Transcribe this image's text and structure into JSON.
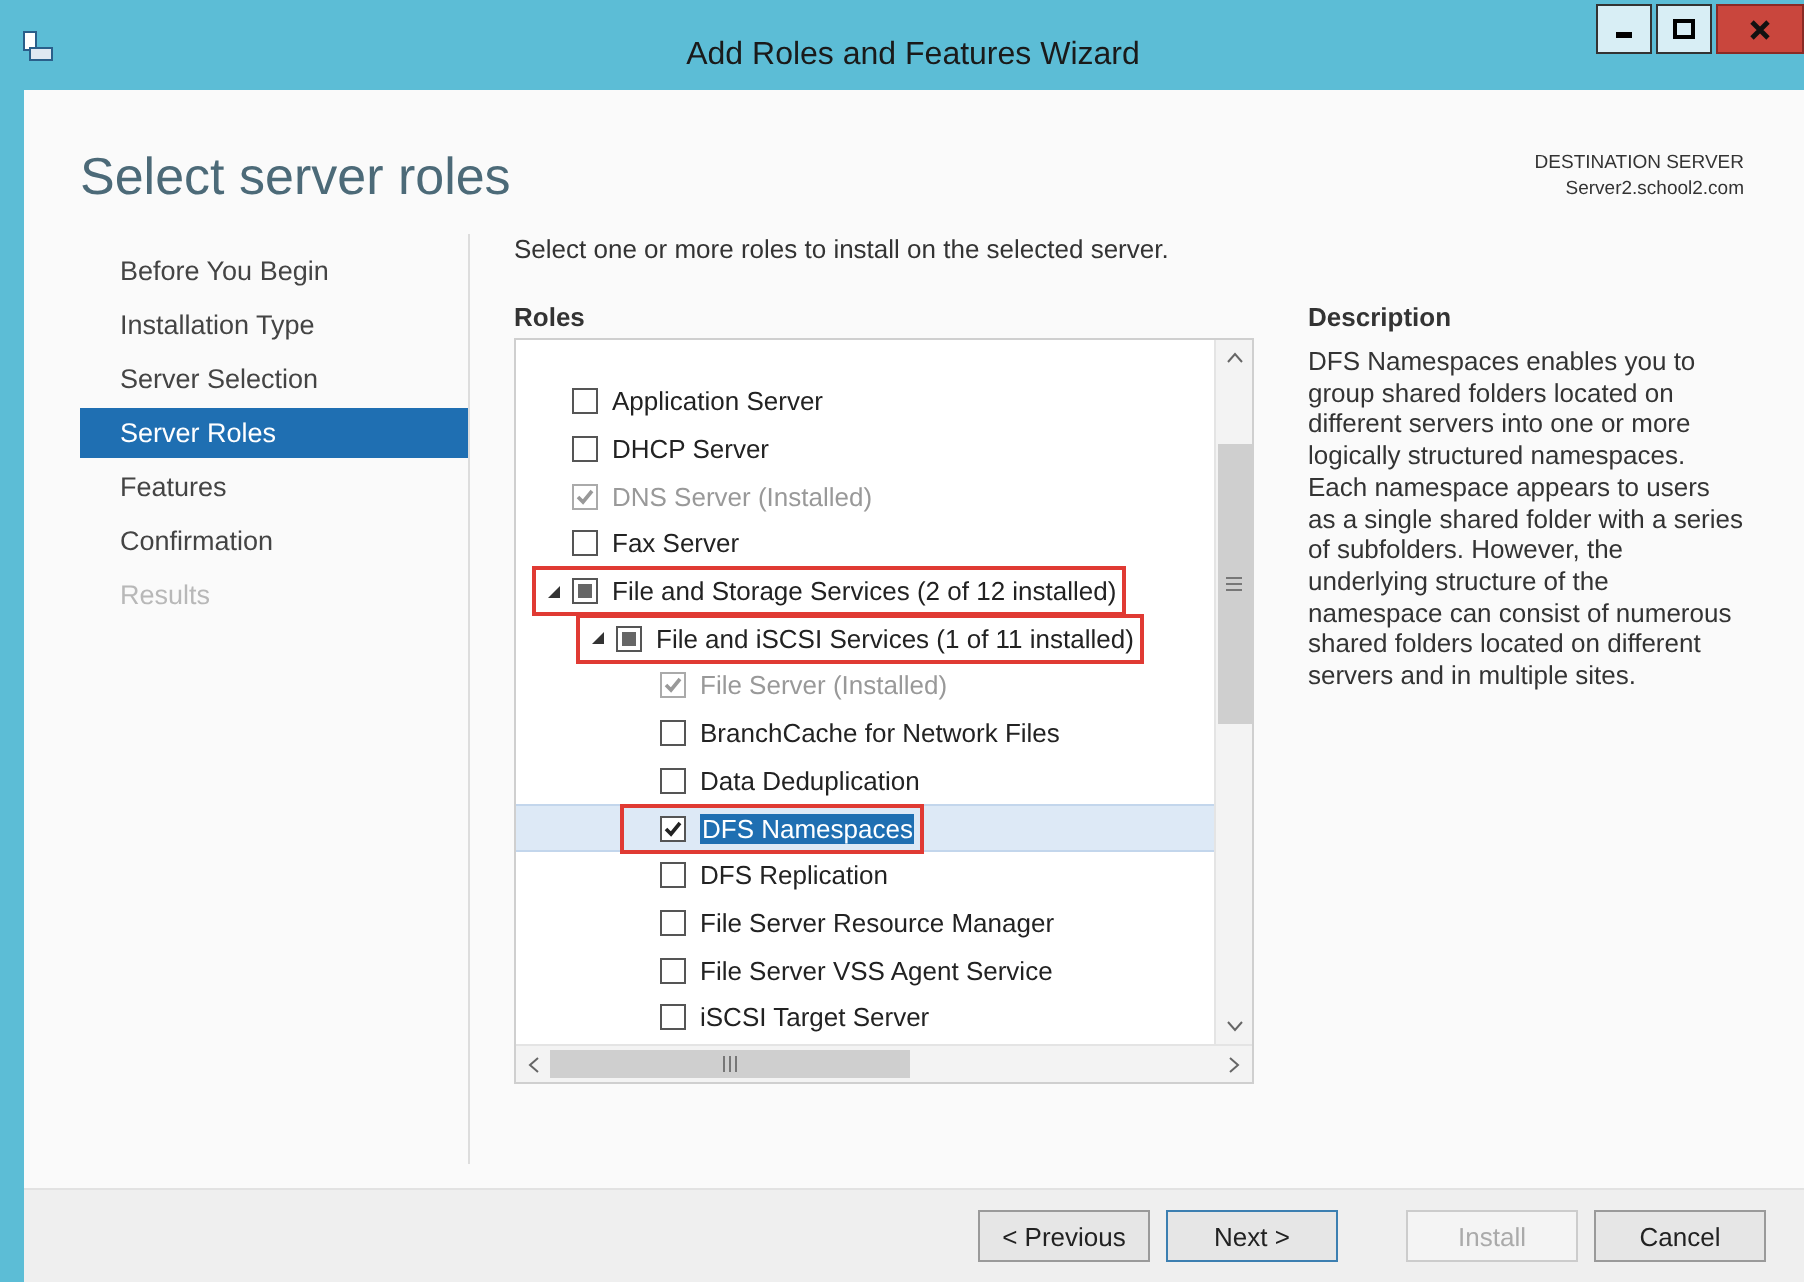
{
  "window": {
    "title": "Add Roles and Features Wizard"
  },
  "page_title": "Select server roles",
  "destination": {
    "label": "DESTINATION SERVER",
    "server": "Server2.school2.com"
  },
  "sidebar": {
    "items": [
      {
        "label": "Before You Begin",
        "selected": false,
        "disabled": false
      },
      {
        "label": "Installation Type",
        "selected": false,
        "disabled": false
      },
      {
        "label": "Server Selection",
        "selected": false,
        "disabled": false
      },
      {
        "label": "Server Roles",
        "selected": true,
        "disabled": false
      },
      {
        "label": "Features",
        "selected": false,
        "disabled": false
      },
      {
        "label": "Confirmation",
        "selected": false,
        "disabled": false
      },
      {
        "label": "Results",
        "selected": false,
        "disabled": true
      }
    ]
  },
  "instruction": "Select one or more roles to install on the selected server.",
  "roles": {
    "heading": "Roles",
    "items": [
      {
        "label": "Application Server",
        "checked": false,
        "partial": false,
        "disabled": false,
        "selected": false,
        "highlighted": false
      },
      {
        "label": "DHCP Server",
        "checked": false,
        "partial": false,
        "disabled": false,
        "selected": false,
        "highlighted": false
      },
      {
        "label": "DNS Server (Installed)",
        "checked": true,
        "partial": false,
        "disabled": true,
        "selected": false,
        "highlighted": false
      },
      {
        "label": "Fax Server",
        "checked": false,
        "partial": false,
        "disabled": false,
        "selected": false,
        "highlighted": false
      },
      {
        "label": "File and Storage Services (2 of 12 installed)",
        "checked": false,
        "partial": true,
        "disabled": false,
        "selected": false,
        "highlighted": true,
        "expanded": true,
        "children": [
          {
            "label": "File and iSCSI Services (1 of 11 installed)",
            "checked": false,
            "partial": true,
            "disabled": false,
            "selected": false,
            "highlighted": true,
            "expanded": true,
            "children": [
              {
                "label": "File Server (Installed)",
                "checked": true,
                "partial": false,
                "disabled": true,
                "selected": false,
                "highlighted": false
              },
              {
                "label": "BranchCache for Network Files",
                "checked": false,
                "partial": false,
                "disabled": false,
                "selected": false,
                "highlighted": false
              },
              {
                "label": "Data Deduplication",
                "checked": false,
                "partial": false,
                "disabled": false,
                "selected": false,
                "highlighted": false
              },
              {
                "label": "DFS Namespaces",
                "checked": true,
                "partial": false,
                "disabled": false,
                "selected": true,
                "highlighted": true
              },
              {
                "label": "DFS Replication",
                "checked": false,
                "partial": false,
                "disabled": false,
                "selected": false,
                "highlighted": false
              },
              {
                "label": "File Server Resource Manager",
                "checked": false,
                "partial": false,
                "disabled": false,
                "selected": false,
                "highlighted": false
              },
              {
                "label": "File Server VSS Agent Service",
                "checked": false,
                "partial": false,
                "disabled": false,
                "selected": false,
                "highlighted": false
              },
              {
                "label": "iSCSI Target Server",
                "checked": false,
                "partial": false,
                "disabled": false,
                "selected": false,
                "highlighted": false
              }
            ]
          }
        ]
      }
    ]
  },
  "description": {
    "heading": "Description",
    "text": "DFS Namespaces enables you to group shared folders located on different servers into one or more logically structured namespaces. Each namespace appears to users as a single shared folder with a series of subfolders. However, the underlying structure of the namespace can consist of numerous shared folders located on different servers and in multiple sites."
  },
  "buttons": [
    {
      "label": "< Previous",
      "disabled": false,
      "selected": false
    },
    {
      "label": "Next >",
      "disabled": false,
      "selected": true
    },
    {
      "label": "Install",
      "disabled": true,
      "selected": false
    },
    {
      "label": "Cancel",
      "disabled": false,
      "selected": false
    }
  ]
}
